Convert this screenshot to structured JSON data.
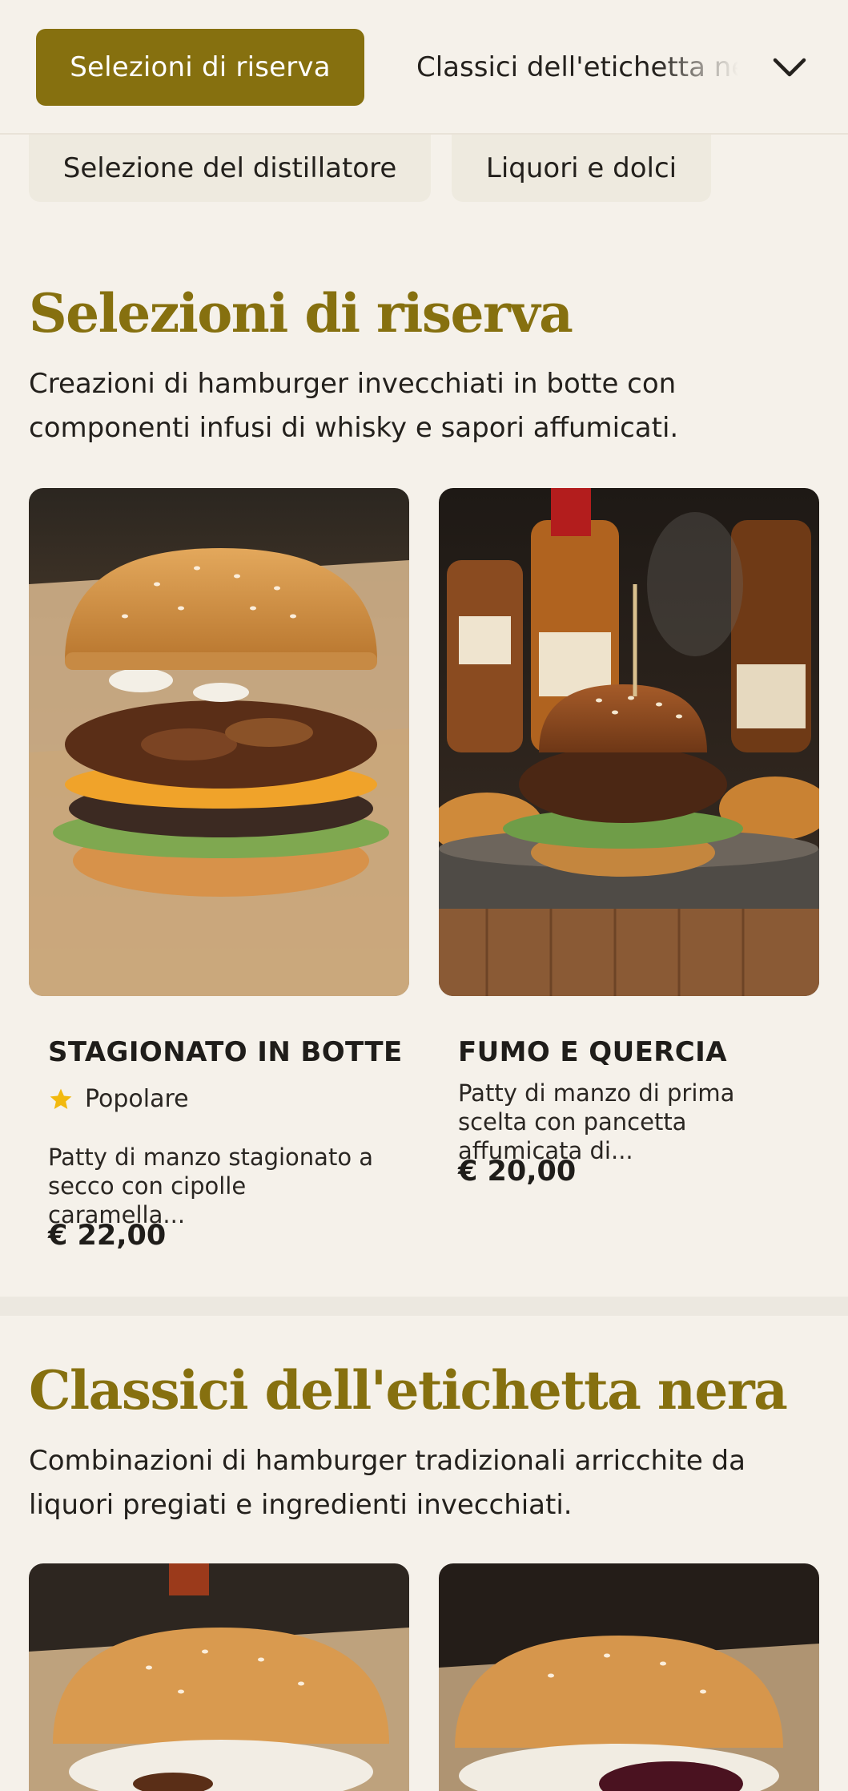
{
  "nav": {
    "active_tab": "Selezioni di riserva",
    "next_tab": "Classici dell'etichetta nera",
    "chips": [
      "Selezione del distillatore",
      "Liquori e dolci"
    ]
  },
  "sections": [
    {
      "title": "Selezioni di riserva",
      "description": "Creazioni di hamburger invecchiati in botte con componenti infusi di whisky e sapori affumicati.",
      "items": [
        {
          "name": "STAGIONATO IN BOTTE",
          "badge": "Popolare",
          "description": "Patty di manzo stagionato a secco con cipolle caramella...",
          "price": "€ 22,00"
        },
        {
          "name": "FUMO E QUERCIA",
          "description": "Patty di manzo di prima scelta con pancetta affumicata di...",
          "price": "€ 20,00"
        }
      ]
    },
    {
      "title": "Classici dell'etichetta nera",
      "description": "Combinazioni di hamburger tradizionali arricchite da liquori pregiati e ingredienti invecchiati."
    }
  ],
  "colors": {
    "accent": "#86700f",
    "background": "#f5f1ea",
    "chip": "#eeeadf",
    "star": "#f2b90f"
  },
  "icons": {
    "dropdown": "chevron-down-icon",
    "badge": "star-icon"
  }
}
